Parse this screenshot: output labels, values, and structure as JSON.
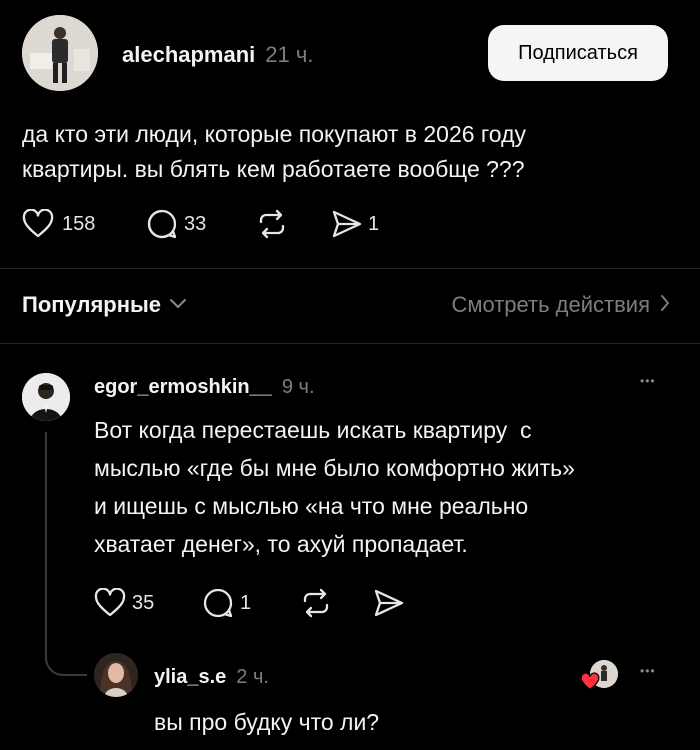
{
  "post": {
    "username": "alechapmani",
    "time": "21 ч.",
    "follow_label": "Подписаться",
    "text_line1": "да кто эти люди, которые покупают в 2026 году",
    "text_line2": "квартиры. вы блять кем работаете вообще ???",
    "likes": "158",
    "comments": "33",
    "shares": "1"
  },
  "sort": {
    "label": "Популярные",
    "activity_label": "Смотреть действия"
  },
  "replies": [
    {
      "username": "egor_ermoshkin__",
      "time": "9 ч.",
      "lines": [
        "Вот когда перестаешь искать квартиру  с",
        "мыслью «где бы мне было комфортно жить»",
        "и ищешь с мыслью «на что мне реально",
        "хватает денег», то ахуй пропадает."
      ],
      "likes": "35",
      "comments": "1",
      "more": "•••"
    },
    {
      "username": "ylia_s.e",
      "time": "2 ч.",
      "text": "вы про будку что ли?",
      "more": "•••"
    }
  ],
  "colors": {
    "background": "#000000",
    "text": "#f3f3f3",
    "muted": "#7d7d7d",
    "follow_bg": "#f5f5f5",
    "liked_heart": "#ff3040"
  },
  "icons": [
    "heart-icon",
    "comment-icon",
    "repost-icon",
    "share-icon",
    "chevron-down-icon",
    "chevron-right-icon",
    "more-icon"
  ]
}
